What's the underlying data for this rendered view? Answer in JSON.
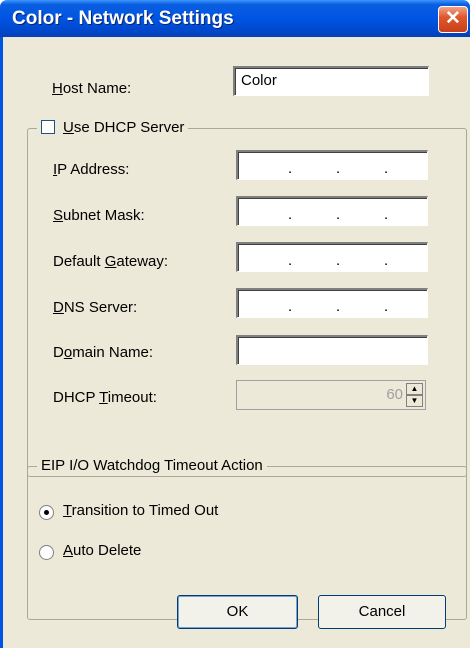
{
  "window": {
    "title": "Color - Network Settings",
    "close_glyph": "✕"
  },
  "host": {
    "label_u": "H",
    "label_rest": "ost Name:",
    "value": "Color"
  },
  "dhcp": {
    "checkbox_label_u": "U",
    "checkbox_label_rest": "se DHCP Server",
    "checked": false,
    "ip_label_u": "I",
    "ip_label_rest": "P Address:",
    "subnet_label_u": "S",
    "subnet_label_rest": "ubnet Mask:",
    "gateway_label_pre": "Default ",
    "gateway_label_u": "G",
    "gateway_label_rest": "ateway:",
    "dns_label_u": "D",
    "dns_label_rest": "NS Server:",
    "domain_label_pre": "D",
    "domain_label_u": "o",
    "domain_label_rest": "main Name:",
    "timeout_label_pre": "DHCP ",
    "timeout_label_u": "T",
    "timeout_label_rest": "imeout:",
    "ip_separator": ".",
    "domain_value": "",
    "timeout_value": "60"
  },
  "watchdog": {
    "legend": "EIP I/O Watchdog Timeout Action",
    "option1_u": "T",
    "option1_rest": "ransition to Timed Out",
    "option1_selected": true,
    "option2_u": "A",
    "option2_rest": "uto Delete",
    "option2_selected": false
  },
  "buttons": {
    "ok": "OK",
    "cancel": "Cancel"
  },
  "icons": {
    "close": "close-icon",
    "spin_up": "▲",
    "spin_down": "▼"
  }
}
